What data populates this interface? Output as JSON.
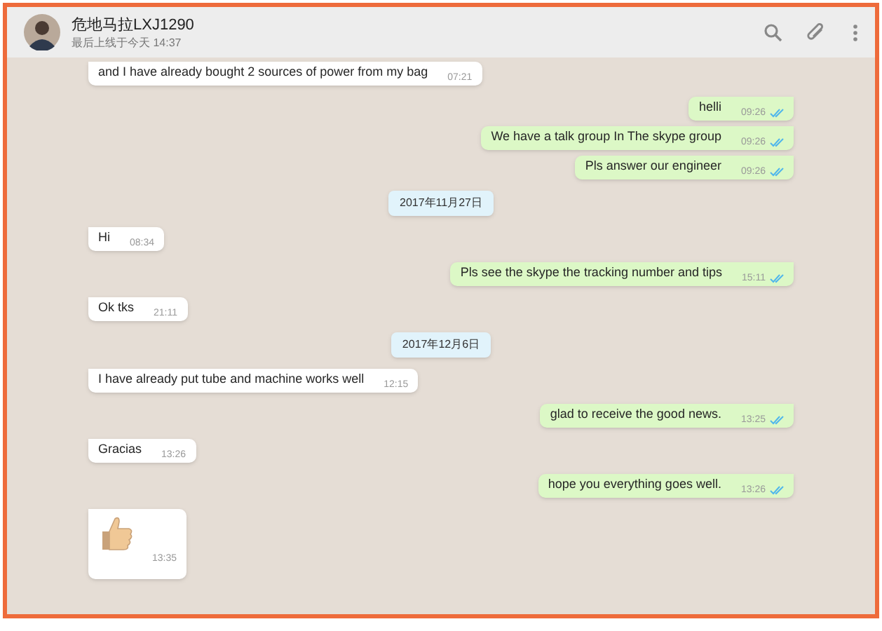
{
  "header": {
    "contact_name": "危地马拉LXJ1290",
    "last_seen": "最后上线于今天 14:37"
  },
  "messages": [
    {
      "kind": "incoming",
      "text": "and I have already bought 2 sources of power from my bag",
      "time": "07:21"
    },
    {
      "kind": "outgoing",
      "text": "helli",
      "time": "09:26",
      "read": true
    },
    {
      "kind": "outgoing",
      "text": "We have a talk group In The skype group",
      "time": "09:26",
      "read": true
    },
    {
      "kind": "outgoing",
      "text": "Pls answer our engineer",
      "time": "09:26",
      "read": true
    },
    {
      "kind": "date",
      "text": "2017年11月27日"
    },
    {
      "kind": "incoming",
      "text": "Hi",
      "time": "08:34"
    },
    {
      "kind": "outgoing",
      "text": "Pls see the skype the tracking number and tips",
      "time": "15:11",
      "read": true
    },
    {
      "kind": "incoming",
      "text": "Ok tks",
      "time": "21:11"
    },
    {
      "kind": "date",
      "text": "2017年12月6日"
    },
    {
      "kind": "incoming",
      "text": "I have already put tube and machine works well",
      "time": "12:15"
    },
    {
      "kind": "outgoing",
      "text": "glad to receive the good news.",
      "time": "13:25",
      "read": true
    },
    {
      "kind": "incoming",
      "text": "Gracias",
      "time": "13:26"
    },
    {
      "kind": "outgoing",
      "text": "hope you everything goes well.",
      "time": "13:26",
      "read": true
    },
    {
      "kind": "sticker",
      "time": "13:35"
    }
  ]
}
